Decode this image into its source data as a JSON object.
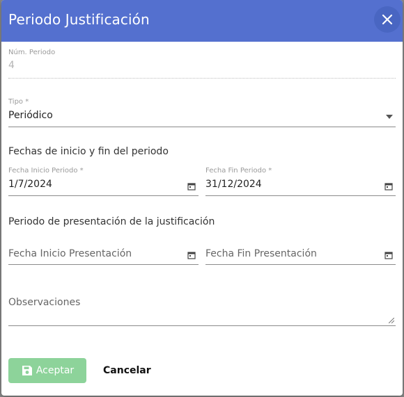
{
  "dialog": {
    "title": "Periodo Justificación",
    "close_icon": "close-icon"
  },
  "num_periodo": {
    "label": "Núm. Periodo",
    "value": "4"
  },
  "tipo": {
    "label": "Tipo *",
    "value": "Periódico",
    "icon": "dropdown-arrow-icon"
  },
  "fechas_periodo": {
    "section_title": "Fechas de inicio y fin del periodo",
    "inicio": {
      "label": "Fecha Inicio Periodo *",
      "value": "1/7/2024",
      "icon": "calendar-icon"
    },
    "fin": {
      "label": "Fecha Fin Periodo *",
      "value": "31/12/2024",
      "icon": "calendar-icon"
    }
  },
  "presentacion": {
    "section_title": "Periodo de presentación de la justificación",
    "inicio": {
      "placeholder": "Fecha Inicio Presentación",
      "icon": "calendar-icon"
    },
    "fin": {
      "placeholder": "Fecha Fin Presentación",
      "icon": "calendar-icon"
    }
  },
  "observaciones": {
    "placeholder": "Observaciones"
  },
  "actions": {
    "accept_label": "Aceptar",
    "accept_icon": "save-icon",
    "cancel_label": "Cancelar"
  },
  "colors": {
    "header": "#5470cf",
    "accept_disabled": "#8dd39a"
  }
}
